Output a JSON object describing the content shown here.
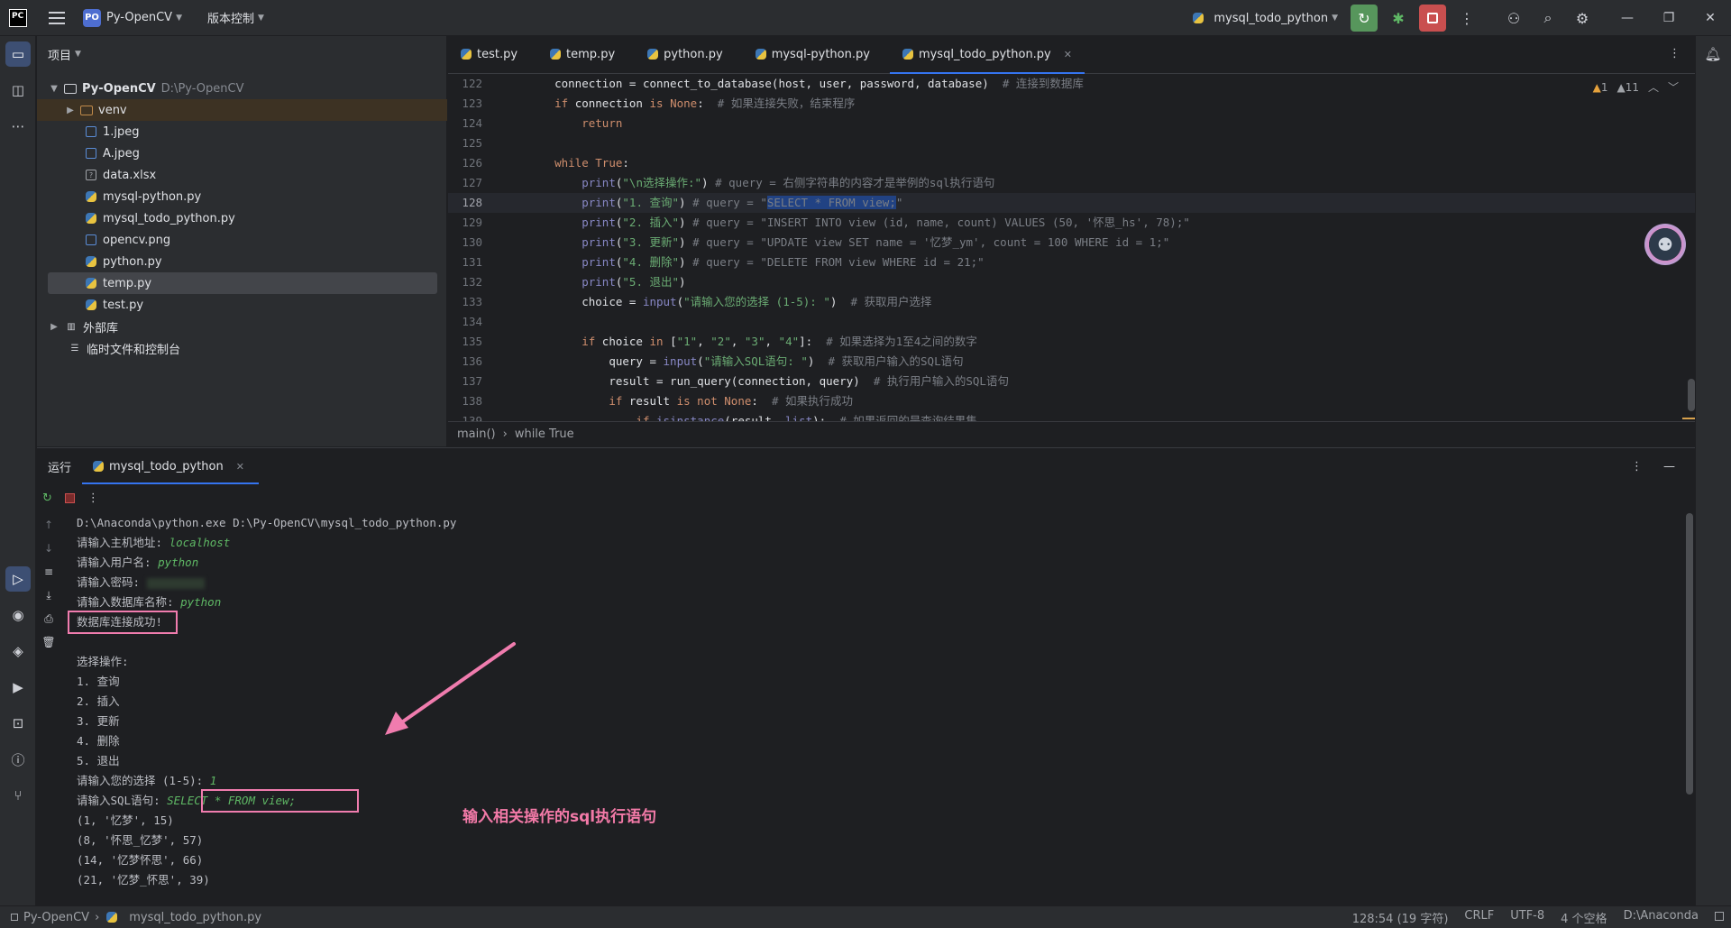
{
  "titlebar": {
    "logo": "PC",
    "project_badge": "PO",
    "project_name": "Py-OpenCV",
    "vcs_label": "版本控制",
    "run_config": "mysql_todo_python"
  },
  "project_panel": {
    "header": "项目",
    "root_name": "Py-OpenCV",
    "root_path": "D:\\Py-OpenCV",
    "items": [
      {
        "label": "venv",
        "type": "folder"
      },
      {
        "label": "1.jpeg",
        "type": "image"
      },
      {
        "label": "A.jpeg",
        "type": "image"
      },
      {
        "label": "data.xlsx",
        "type": "unknown"
      },
      {
        "label": "mysql-python.py",
        "type": "python"
      },
      {
        "label": "mysql_todo_python.py",
        "type": "python"
      },
      {
        "label": "opencv.png",
        "type": "image"
      },
      {
        "label": "python.py",
        "type": "python"
      },
      {
        "label": "temp.py",
        "type": "python"
      },
      {
        "label": "test.py",
        "type": "python"
      }
    ],
    "external_libs": "外部库",
    "scratches": "临时文件和控制台"
  },
  "editor": {
    "tabs": [
      "test.py",
      "temp.py",
      "python.py",
      "mysql-python.py",
      "mysql_todo_python.py"
    ],
    "active_tab": "mysql_todo_python.py",
    "warnings": "1",
    "weak_warnings": "11",
    "line_numbers": [
      "122",
      "123",
      "124",
      "125",
      "126",
      "127",
      "128",
      "129",
      "130",
      "131",
      "132",
      "133",
      "134",
      "135",
      "136",
      "137",
      "138",
      "139"
    ],
    "breadcrumb": [
      "main()",
      "while True"
    ],
    "code": {
      "l122": [
        "connection = connect_to_database(host, user, password, database)  ",
        "# 连接到数据库"
      ],
      "l123": [
        "if",
        " connection ",
        "is",
        " ",
        "None",
        ":  ",
        "# 如果连接失败，结束程序"
      ],
      "l124": "return",
      "l126": [
        "while",
        " ",
        "True",
        ":"
      ],
      "l127": [
        "print",
        "(",
        "\"\\n选择操作:\"",
        ")",
        " # query = 右侧字符串的内容才是举例的sql执行语句"
      ],
      "l128": [
        "print",
        "(",
        "\"1. 查询\"",
        ")",
        " # query = \"",
        "SELECT * FROM view;",
        "\""
      ],
      "l129": [
        "print",
        "(",
        "\"2. 插入\"",
        ")",
        " # query = \"INSERT INTO view (id, name, count) VALUES (50, '怀思_hs', 78);\""
      ],
      "l130": [
        "print",
        "(",
        "\"3. 更新\"",
        ")",
        " # query = \"UPDATE view SET name = '忆梦_ym', count = 100 WHERE id = 1;\""
      ],
      "l131": [
        "print",
        "(",
        "\"4. 删除\"",
        ")",
        " # query = \"DELETE FROM view WHERE id = 21;\""
      ],
      "l132": [
        "print",
        "(",
        "\"5. 退出\"",
        ")"
      ],
      "l133": [
        "choice = ",
        "input",
        "(",
        "\"请输入您的选择 (1-5): \"",
        ")  ",
        "# 获取用户选择"
      ],
      "l135": [
        "if",
        " choice ",
        "in",
        " [",
        "\"1\"",
        ", ",
        "\"2\"",
        ", ",
        "\"3\"",
        ", ",
        "\"4\"",
        "]:  ",
        "# 如果选择为1至4之间的数字"
      ],
      "l136": [
        "query = ",
        "input",
        "(",
        "\"请输入SQL语句: \"",
        ")  ",
        "# 获取用户输入的SQL语句"
      ],
      "l137": [
        "result = run_query(connection, query)  ",
        "# 执行用户输入的SQL语句"
      ],
      "l138": [
        "if",
        " result ",
        "is not",
        " ",
        "None",
        ":  ",
        "# 如果执行成功"
      ],
      "l139": [
        "if",
        " ",
        "isinstance",
        "(result, ",
        "list",
        "):  ",
        "# 如果返回的是查询结果集"
      ]
    }
  },
  "run_panel": {
    "title": "运行",
    "tab": "mysql_todo_python",
    "output": {
      "cmd": "D:\\Anaconda\\python.exe D:\\Py-OpenCV\\mysql_todo_python.py",
      "host_prompt": "请输入主机地址: ",
      "host_value": "localhost",
      "user_prompt": "请输入用户名: ",
      "user_value": "python",
      "pwd_prompt": "请输入密码: ",
      "db_prompt": "请输入数据库名称: ",
      "db_value": "python",
      "connected": "数据库连接成功!",
      "menu_title": "选择操作:",
      "menu": [
        "1. 查询",
        "2. 插入",
        "3. 更新",
        "4. 删除",
        "5. 退出"
      ],
      "choice_prompt": "请输入您的选择 (1-5): ",
      "choice_value": "1",
      "sql_prompt": "请输入SQL语句:",
      "sql_value": "SELECT * FROM view;",
      "rows": [
        "(1, '忆梦', 15)",
        "(8, '怀思_忆梦', 57)",
        "(14, '忆梦怀思', 66)",
        "(21, '忆梦_怀思', 39)"
      ]
    },
    "annotation": "输入相关操作的sql执行语句"
  },
  "statusbar": {
    "project": "Py-OpenCV",
    "file": "mysql_todo_python.py",
    "position": "128:54 (19 字符)",
    "line_sep": "CRLF",
    "encoding": "UTF-8",
    "indent": "4 个空格",
    "interpreter": "D:\\Anaconda"
  },
  "colors": {
    "accent": "#3574f0",
    "annotation": "#f07cae",
    "keyword": "#cf8e6d",
    "string": "#6aab73",
    "function": "#56a8f5"
  }
}
